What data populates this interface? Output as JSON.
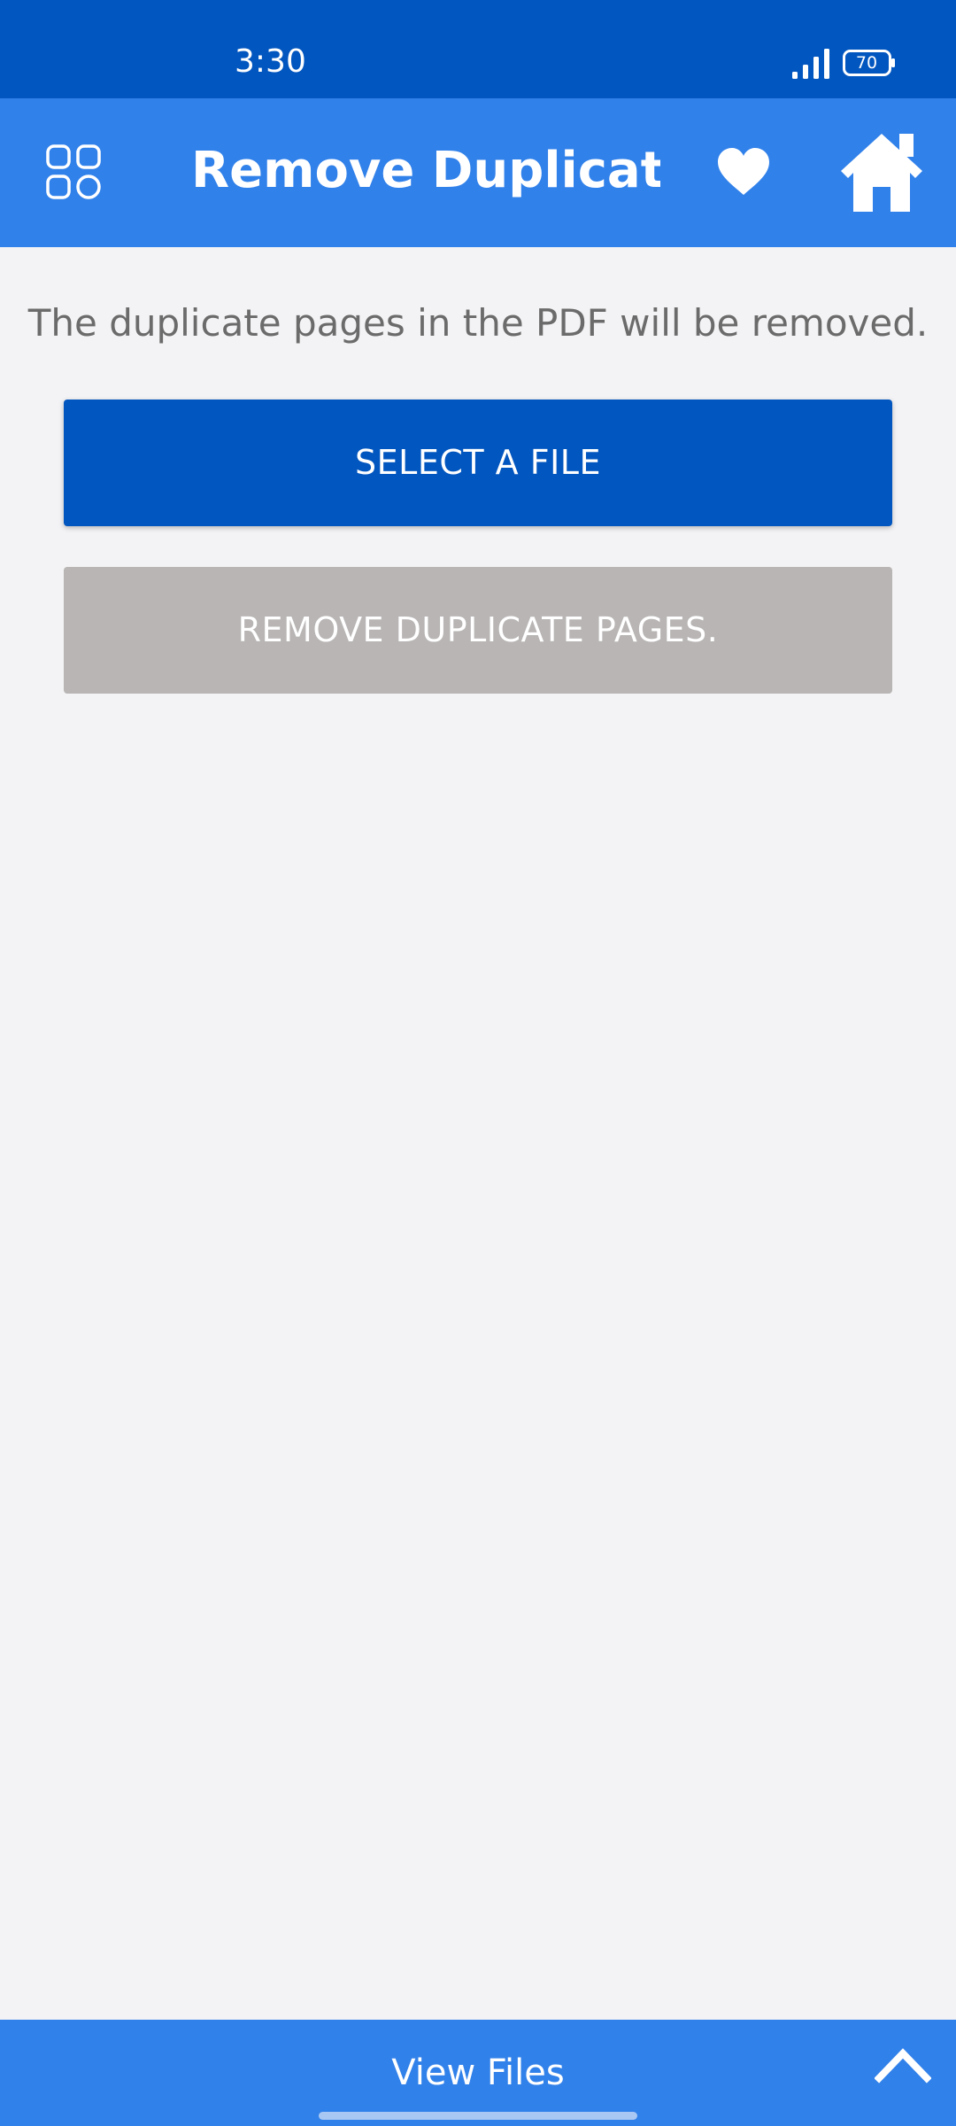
{
  "status_bar": {
    "time": "3:30",
    "battery_level": "70"
  },
  "toolbar": {
    "title": "Remove Duplicate…",
    "apps_icon": "apps-grid-icon",
    "favorite_icon": "heart-icon",
    "home_icon": "home-icon"
  },
  "main": {
    "description": "The duplicate pages in the PDF will be removed.",
    "select_file_label": "SELECT A FILE",
    "remove_duplicates_label": "REMOVE DUPLICATE PAGES."
  },
  "bottom_bar": {
    "view_files_label": "View Files",
    "expand_icon": "chevron-up-icon"
  },
  "colors": {
    "status_bar": "#0256bf",
    "toolbar": "#3181ea",
    "primary_button": "#0256bf",
    "disabled_button": "#b8b5b4",
    "background": "#f3f3f5",
    "description_text": "#6b6b6b"
  }
}
